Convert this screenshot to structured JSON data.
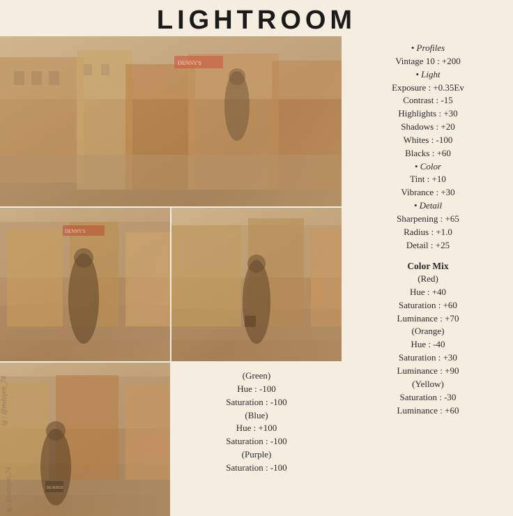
{
  "title": "LIGHTROOM",
  "watermark": "ig : @mduyen_74",
  "right_panel": {
    "lines": [
      {
        "text": "• Profiles",
        "type": "bullet"
      },
      {
        "text": "Vintage 10 : +200",
        "type": "line"
      },
      {
        "text": "• Light",
        "type": "bullet"
      },
      {
        "text": "Exposure : +0.35Ev",
        "type": "line"
      },
      {
        "text": "Contrast : -15",
        "type": "line"
      },
      {
        "text": "Highlights : +30",
        "type": "line"
      },
      {
        "text": "Shadows : +20",
        "type": "line"
      },
      {
        "text": "Whites : -100",
        "type": "line"
      },
      {
        "text": "Blacks : +60",
        "type": "line"
      },
      {
        "text": "• Color",
        "type": "bullet"
      },
      {
        "text": "Tint : +10",
        "type": "line"
      },
      {
        "text": "Vibrance : +30",
        "type": "line"
      },
      {
        "text": "• Detail",
        "type": "bullet"
      },
      {
        "text": "Sharpening : +65",
        "type": "line"
      },
      {
        "text": "Radius : +1.0",
        "type": "line"
      },
      {
        "text": "Detail : +25",
        "type": "line"
      },
      {
        "text": "",
        "type": "spacer"
      },
      {
        "text": "Color Mix",
        "type": "section"
      },
      {
        "text": "(Red)",
        "type": "line"
      },
      {
        "text": "Hue : +40",
        "type": "line"
      },
      {
        "text": "Saturation : +60",
        "type": "line"
      },
      {
        "text": "Luminance : +70",
        "type": "line"
      },
      {
        "text": "(Orange)",
        "type": "line"
      },
      {
        "text": "Hue : -40",
        "type": "line"
      },
      {
        "text": "Saturation : +30",
        "type": "line"
      },
      {
        "text": "Luminance : +90",
        "type": "line"
      },
      {
        "text": "(Yellow)",
        "type": "line"
      },
      {
        "text": "Saturation : -30",
        "type": "line"
      },
      {
        "text": "Luminance : +60",
        "type": "line"
      }
    ]
  },
  "bottom_panel": {
    "lines": [
      {
        "text": "(Green)"
      },
      {
        "text": "Hue : -100"
      },
      {
        "text": "Saturation : -100"
      },
      {
        "text": "(Blue)"
      },
      {
        "text": "Hue : +100"
      },
      {
        "text": "Saturation : -100"
      },
      {
        "text": "(Purple)"
      },
      {
        "text": "Saturation : -100"
      }
    ]
  }
}
